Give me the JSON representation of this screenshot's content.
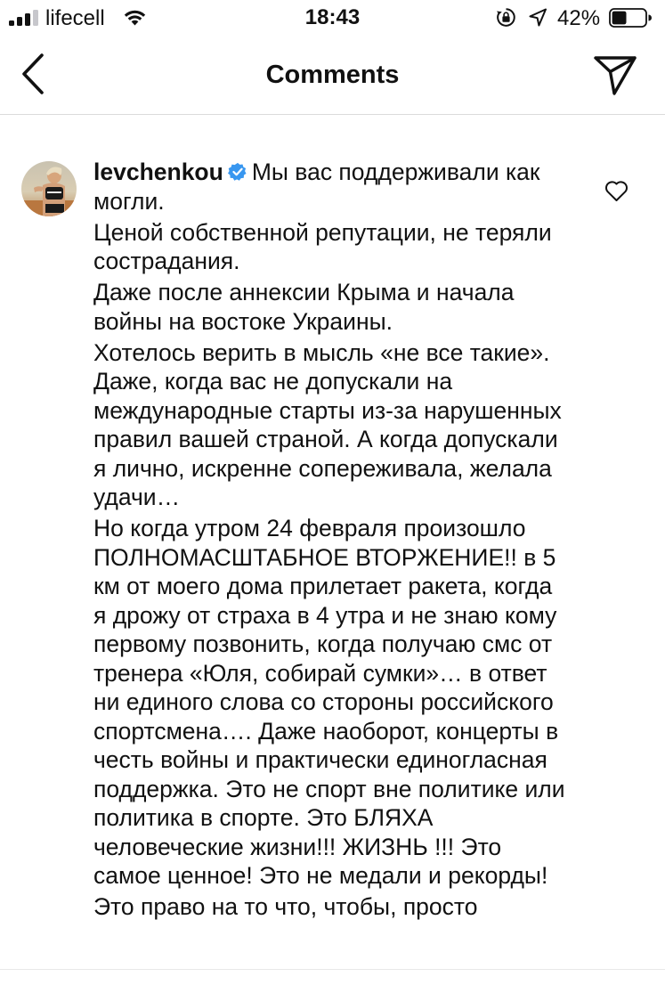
{
  "status_bar": {
    "carrier": "lifecell",
    "time": "18:43",
    "battery_percent": "42%",
    "battery_level": 0.42
  },
  "nav": {
    "title": "Comments",
    "back_icon": "chevron-left-icon",
    "share_icon": "paper-plane-icon"
  },
  "comment": {
    "username": "levchenkou",
    "verified": true,
    "paragraphs": [
      "Мы вас поддерживали как могли.",
      "Ценой собственной репутации, не теряли сострадания.",
      "Даже после аннексии Крыма и начала войны на востоке Украины.",
      "Хотелось верить в мысль «не все такие». Даже, когда вас не допускали на международные старты из-за нарушенных правил вашей страной. А когда допускали я лично, искренне сопереживала, желала удачи…",
      "Но когда утром 24 февраля произошло ПОЛНОМАСШТАБНОЕ ВТОРЖЕНИЕ!! в 5 км от моего дома прилетает ракета, когда я дрожу от страха в 4 утра и не знаю кому первому позвонить, когда получаю смс от тренера «Юля, собирай сумки»… в ответ ни единого слова со стороны российского спортсмена…. Даже наоборот, концерты в честь войны и практически единогласная поддержка. Это не спорт вне политике или политика в спорте. Это БЛЯХА человеческие жизни!!! ЖИЗНЬ !!! Это самое ценное! Это не медали и рекорды!",
      "Это право на то что, чтобы, просто"
    ]
  },
  "colors": {
    "text": "#111111",
    "divider": "#dbdbdb",
    "verified_badge": "#3897f0",
    "icon": "#111111"
  }
}
